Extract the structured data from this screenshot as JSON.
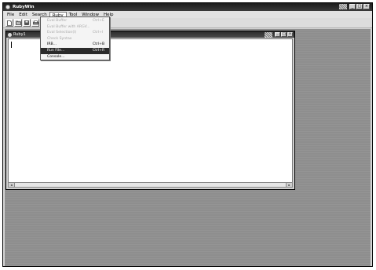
{
  "app": {
    "title": "RubyWin"
  },
  "window_buttons": {
    "minimize": "_",
    "maximize": "□",
    "close": "×"
  },
  "menubar": {
    "items": [
      {
        "label": "File"
      },
      {
        "label": "Edit"
      },
      {
        "label": "Search"
      },
      {
        "label": "Ruby"
      },
      {
        "label": "Tool"
      },
      {
        "label": "Window"
      },
      {
        "label": "Help"
      }
    ]
  },
  "toolbar": {
    "icons": [
      "new-file-icon",
      "open-folder-icon",
      "save-icon",
      "print-icon"
    ]
  },
  "document": {
    "title": "Ruby1"
  },
  "ruby_menu": {
    "items": [
      {
        "label": "Eval Buffer",
        "shortcut": "Ctrl+E",
        "state": "disabled"
      },
      {
        "label": "Eval Buffer with ARGV...",
        "shortcut": "",
        "state": "disabled"
      },
      {
        "label": "Eval Selection(I)",
        "shortcut": "Ctrl+I",
        "state": "disabled"
      },
      {
        "label": "Check Syntax",
        "shortcut": "",
        "state": "disabled"
      },
      {
        "label": "IRB...",
        "shortcut": "Ctrl+B",
        "state": "enabled"
      },
      {
        "label": "Run File...",
        "shortcut": "Ctrl+R",
        "state": "highlighted"
      },
      {
        "label": "Console...",
        "shortcut": "",
        "state": "enabled"
      }
    ]
  },
  "colors": {
    "highlight": "#2a2a2a",
    "disabled_text": "#a8a8a8",
    "workspace": "#8e8e8e"
  }
}
